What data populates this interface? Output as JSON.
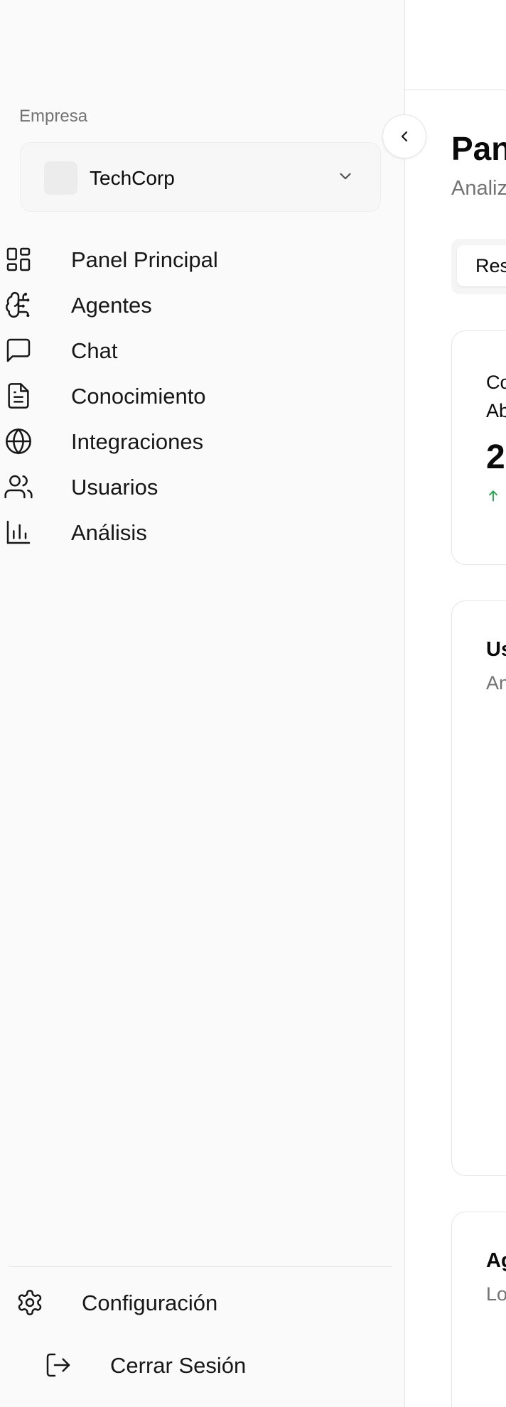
{
  "sidebar": {
    "company_label": "Empresa",
    "company_name": "TechCorp",
    "items": [
      {
        "label": "Panel Principal",
        "icon": "layout-grid-icon"
      },
      {
        "label": "Agentes",
        "icon": "brain-circuit-icon"
      },
      {
        "label": "Chat",
        "icon": "message-square-icon"
      },
      {
        "label": "Conocimiento",
        "icon": "file-text-icon"
      },
      {
        "label": "Integraciones",
        "icon": "globe-icon"
      },
      {
        "label": "Usuarios",
        "icon": "users-icon"
      },
      {
        "label": "Análisis",
        "icon": "bar-chart-icon"
      }
    ],
    "settings_label": "Configuración",
    "logout_label": "Cerrar Sesión"
  },
  "main": {
    "title": "Pan",
    "subtitle": "Analiz",
    "active_tab": "Res",
    "stat_card": {
      "label": "Co Ab",
      "label_line1": "Co",
      "label_line2": "Ab",
      "value": "2"
    },
    "usage_card": {
      "title": "Us",
      "desc": "An"
    },
    "agents_card": {
      "title": "Ag",
      "desc": "Lo"
    }
  },
  "colors": {
    "sidebar_bg": "#fafafa",
    "border": "#e5e5e5",
    "muted_text": "#737373",
    "trend_up": "#22a34a"
  }
}
